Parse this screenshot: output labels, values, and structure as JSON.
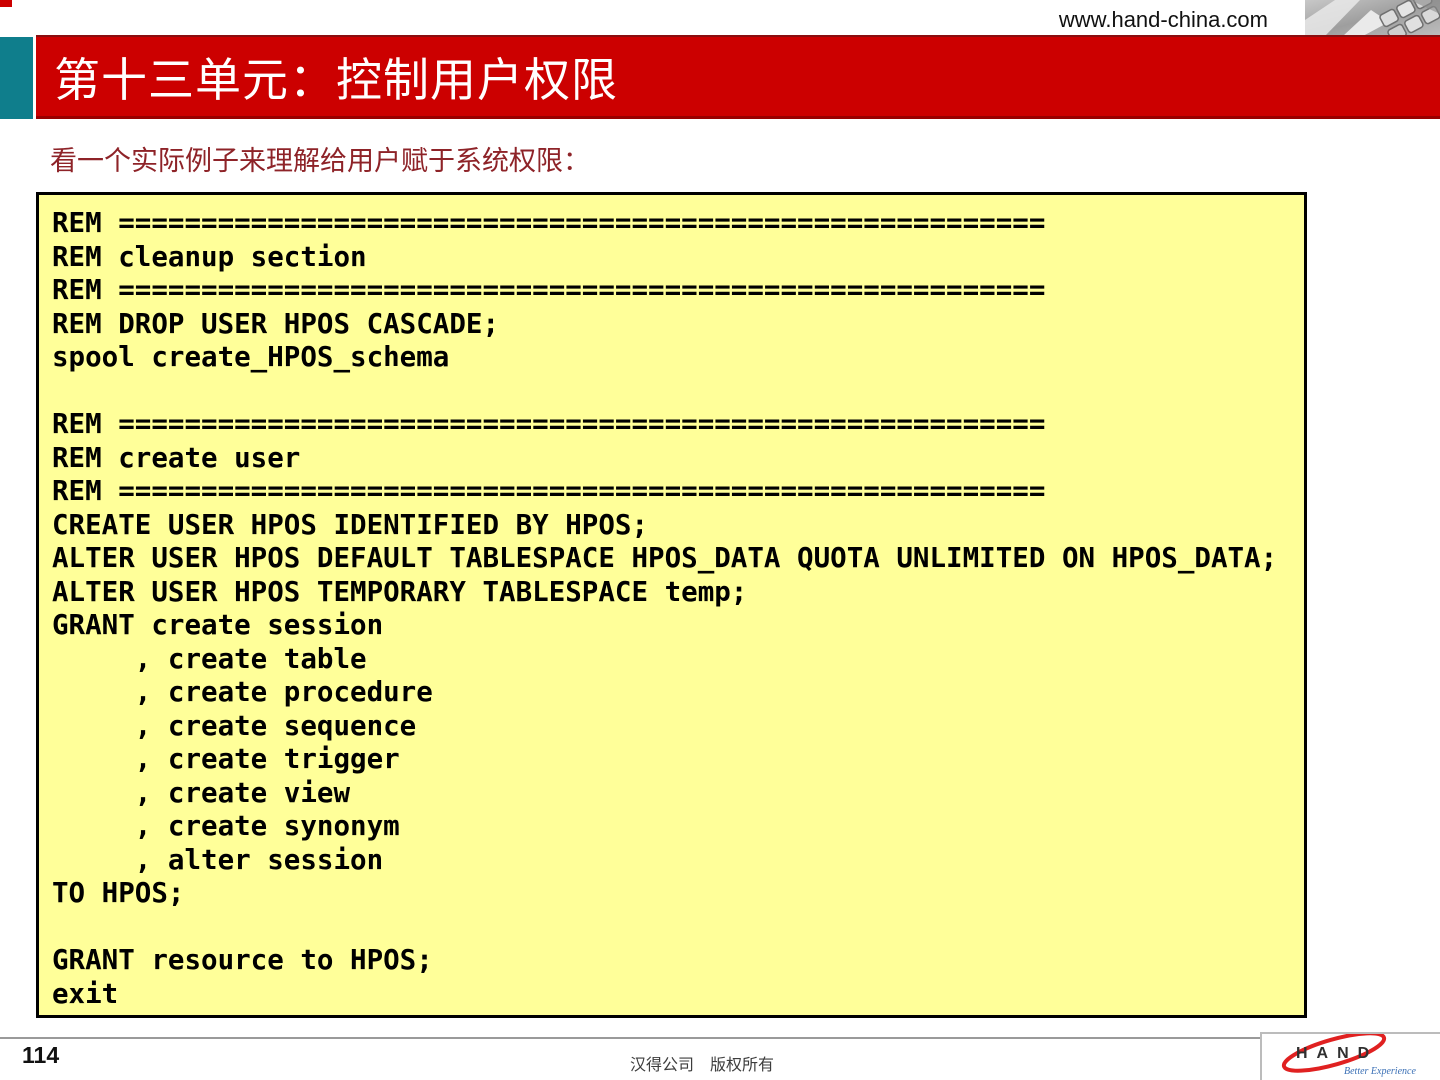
{
  "header": {
    "website_url": "www.hand-china.com",
    "title": "第十三单元：控制用户权限"
  },
  "subtitle": {
    "text": "看一个实际例子来理解给用户赋于系统权限："
  },
  "code_block": {
    "lines": [
      "REM ========================================================",
      "REM cleanup section",
      "REM ========================================================",
      "REM DROP USER HPOS CASCADE;",
      "spool create_HPOS_schema",
      "",
      "REM ========================================================",
      "REM create user",
      "REM ========================================================",
      "CREATE USER HPOS IDENTIFIED BY HPOS;",
      "ALTER USER HPOS DEFAULT TABLESPACE HPOS_DATA QUOTA UNLIMITED ON HPOS_DATA;",
      "ALTER USER HPOS TEMPORARY TABLESPACE temp;",
      "GRANT create session",
      "     , create table",
      "     , create procedure",
      "     , create sequence",
      "     , create trigger",
      "     , create view",
      "     , create synonym",
      "     , alter session",
      "TO HPOS;",
      "",
      "GRANT resource to HPOS;",
      "exit"
    ]
  },
  "footer": {
    "page_number": "114",
    "copyright": "汉得公司　版权所有",
    "logo": {
      "name": "HAND",
      "tagline": "Better Experience"
    }
  },
  "colors": {
    "banner_red": "#cc0000",
    "banner_red_dark": "#990000",
    "teal_accent": "#0f7e8c",
    "code_background": "#ffff99",
    "subtitle_maroon": "#8e2328",
    "logo_swoosh_red": "#e02121",
    "logo_tagline_blue": "#3a6fb5"
  }
}
